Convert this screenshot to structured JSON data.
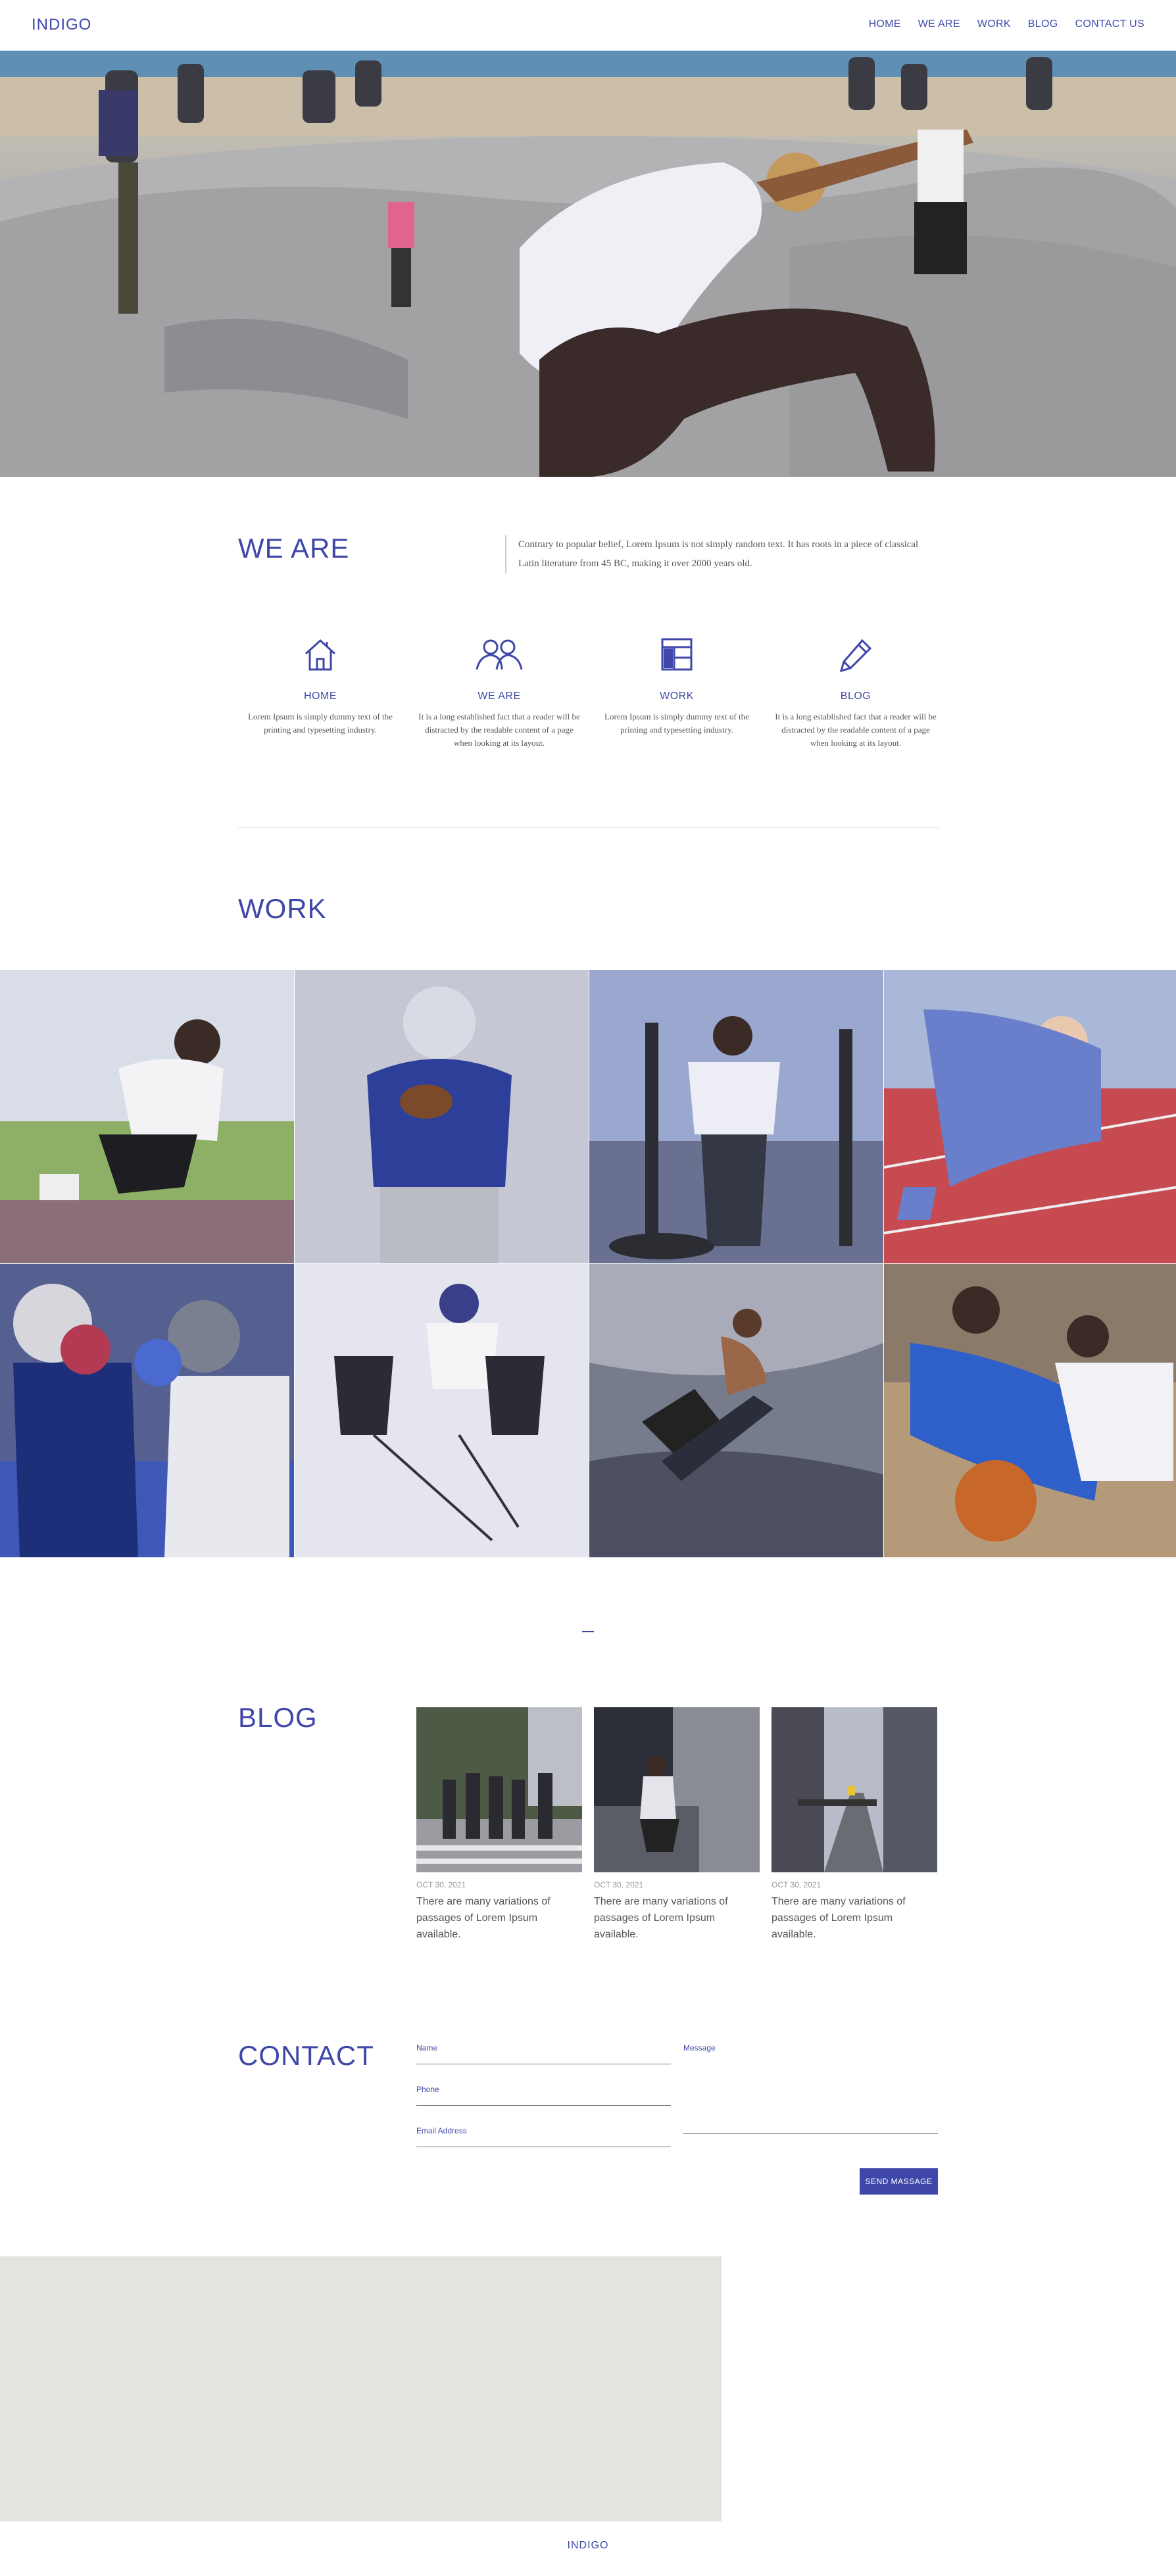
{
  "header": {
    "logo": "INDIGO",
    "nav": [
      "HOME",
      "WE ARE",
      "WORK",
      "BLOG",
      "CONTACT US"
    ]
  },
  "we_are": {
    "title": "WE ARE",
    "text": "Contrary to popular belief, Lorem Ipsum is not simply random text. It has roots in a piece of classical Latin literature from 45 BC, making it over 2000 years old.",
    "features": [
      {
        "icon": "home-icon",
        "title": "HOME",
        "text": "Lorem Ipsum is simply dummy text of the printing and typesetting industry."
      },
      {
        "icon": "people-icon",
        "title": "WE ARE",
        "text": "It is a long established fact that a reader will be distracted by the readable content of a page when looking at its layout."
      },
      {
        "icon": "layout-icon",
        "title": "WORK",
        "text": "Lorem Ipsum is simply dummy text of the printing and typesetting industry."
      },
      {
        "icon": "pencil-icon",
        "title": "BLOG",
        "text": "It is a long established fact that a reader will be distracted by the readable content of a page when looking at its layout."
      }
    ]
  },
  "work": {
    "title": "WORK"
  },
  "blog": {
    "title": "BLOG",
    "posts": [
      {
        "date": "OCT 30, 2021",
        "title": "There are many variations of passages of Lorem Ipsum available."
      },
      {
        "date": "OCT 30, 2021",
        "title": "There are many variations of passages of Lorem Ipsum available."
      },
      {
        "date": "OCT 30, 2021",
        "title": "There are many variations of passages of Lorem Ipsum available."
      }
    ]
  },
  "contact": {
    "title": "CONTACT",
    "name_label": "Name",
    "phone_label": "Phone",
    "email_label": "Email Address",
    "message_label": "Message",
    "send_label": "SEND MASSAGE"
  },
  "footer": {
    "text": "INDIGO"
  },
  "colors": {
    "accent": "#3f48a8",
    "map_bg": "#e4e3df"
  }
}
